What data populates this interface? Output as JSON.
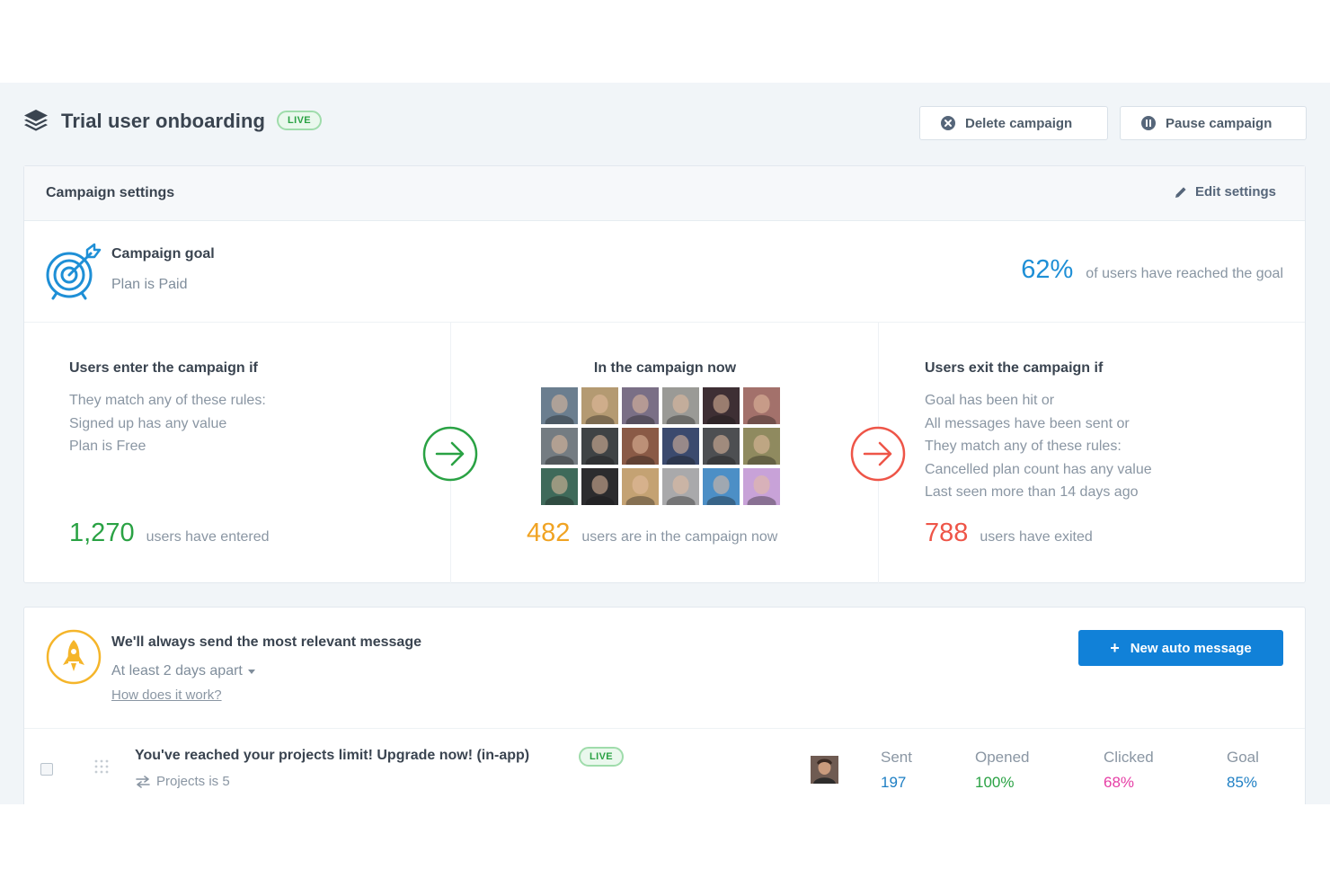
{
  "header": {
    "title": "Trial user onboarding",
    "status": "LIVE",
    "delete_label": "Delete campaign",
    "pause_label": "Pause campaign"
  },
  "settings": {
    "title": "Campaign settings",
    "edit_label": "Edit settings",
    "goal": {
      "title": "Campaign goal",
      "value": "Plan is Paid",
      "percent": "62%",
      "percent_text": "of users have reached the goal"
    },
    "enter": {
      "title": "Users enter the campaign if",
      "rules": [
        "They match any of these rules:",
        "Signed up has any value",
        "Plan is Free"
      ],
      "count": "1,270",
      "count_text": "users have entered"
    },
    "now": {
      "title": "In the campaign now",
      "avatars": [
        "#6b7e8f",
        "#b49a72",
        "#7a6f86",
        "#9a9a96",
        "#3e2f34",
        "#a3716b",
        "#747c82",
        "#3f4345",
        "#8a5a46",
        "#3b4a6e",
        "#4d4f52",
        "#8f8a5f",
        "#3f6a5a",
        "#2c2c2e",
        "#c4a273",
        "#a9a9ab",
        "#4c8fc6",
        "#c8a2d8"
      ],
      "count": "482",
      "count_text": "users are in the campaign now"
    },
    "exit": {
      "title": "Users exit the campaign if",
      "rules": [
        "Goal has been hit or",
        "All messages have been sent or",
        "They match any of these rules:",
        "Cancelled plan count has any value",
        "Last seen more than 14 days ago"
      ],
      "count": "788",
      "count_text": "users have exited"
    }
  },
  "messages": {
    "title": "We'll always send the most relevant message",
    "interval": "At least 2 days apart",
    "help_link": "How does it work?",
    "new_button": "New auto message",
    "rows": [
      {
        "title": "You've reached your projects limit! Upgrade now! (in-app)",
        "status": "LIVE",
        "rule": "Projects is 5",
        "metrics": [
          {
            "label": "Sent",
            "value": "197"
          },
          {
            "label": "Opened",
            "value": "100%"
          },
          {
            "label": "Clicked",
            "value": "68%"
          },
          {
            "label": "Goal",
            "value": "85%"
          }
        ]
      }
    ]
  },
  "colors": {
    "accent_blue": "#1181d8",
    "enter_green": "#2aa244",
    "now_amber": "#f0a323",
    "exit_red": "#ee5548",
    "clicked_magenta": "#e63ea5"
  },
  "icons": {
    "title": "stack-layers-icon",
    "delete": "close-circle-icon",
    "pause": "pause-circle-icon",
    "edit": "pencil-icon",
    "goal": "target-arrow-icon",
    "enter_arrow": "arrow-right-circle-icon",
    "exit_arrow": "arrow-right-circle-icon",
    "messages": "rocket-icon",
    "rule": "swap-arrows-icon",
    "drag": "drag-handle-icon"
  }
}
